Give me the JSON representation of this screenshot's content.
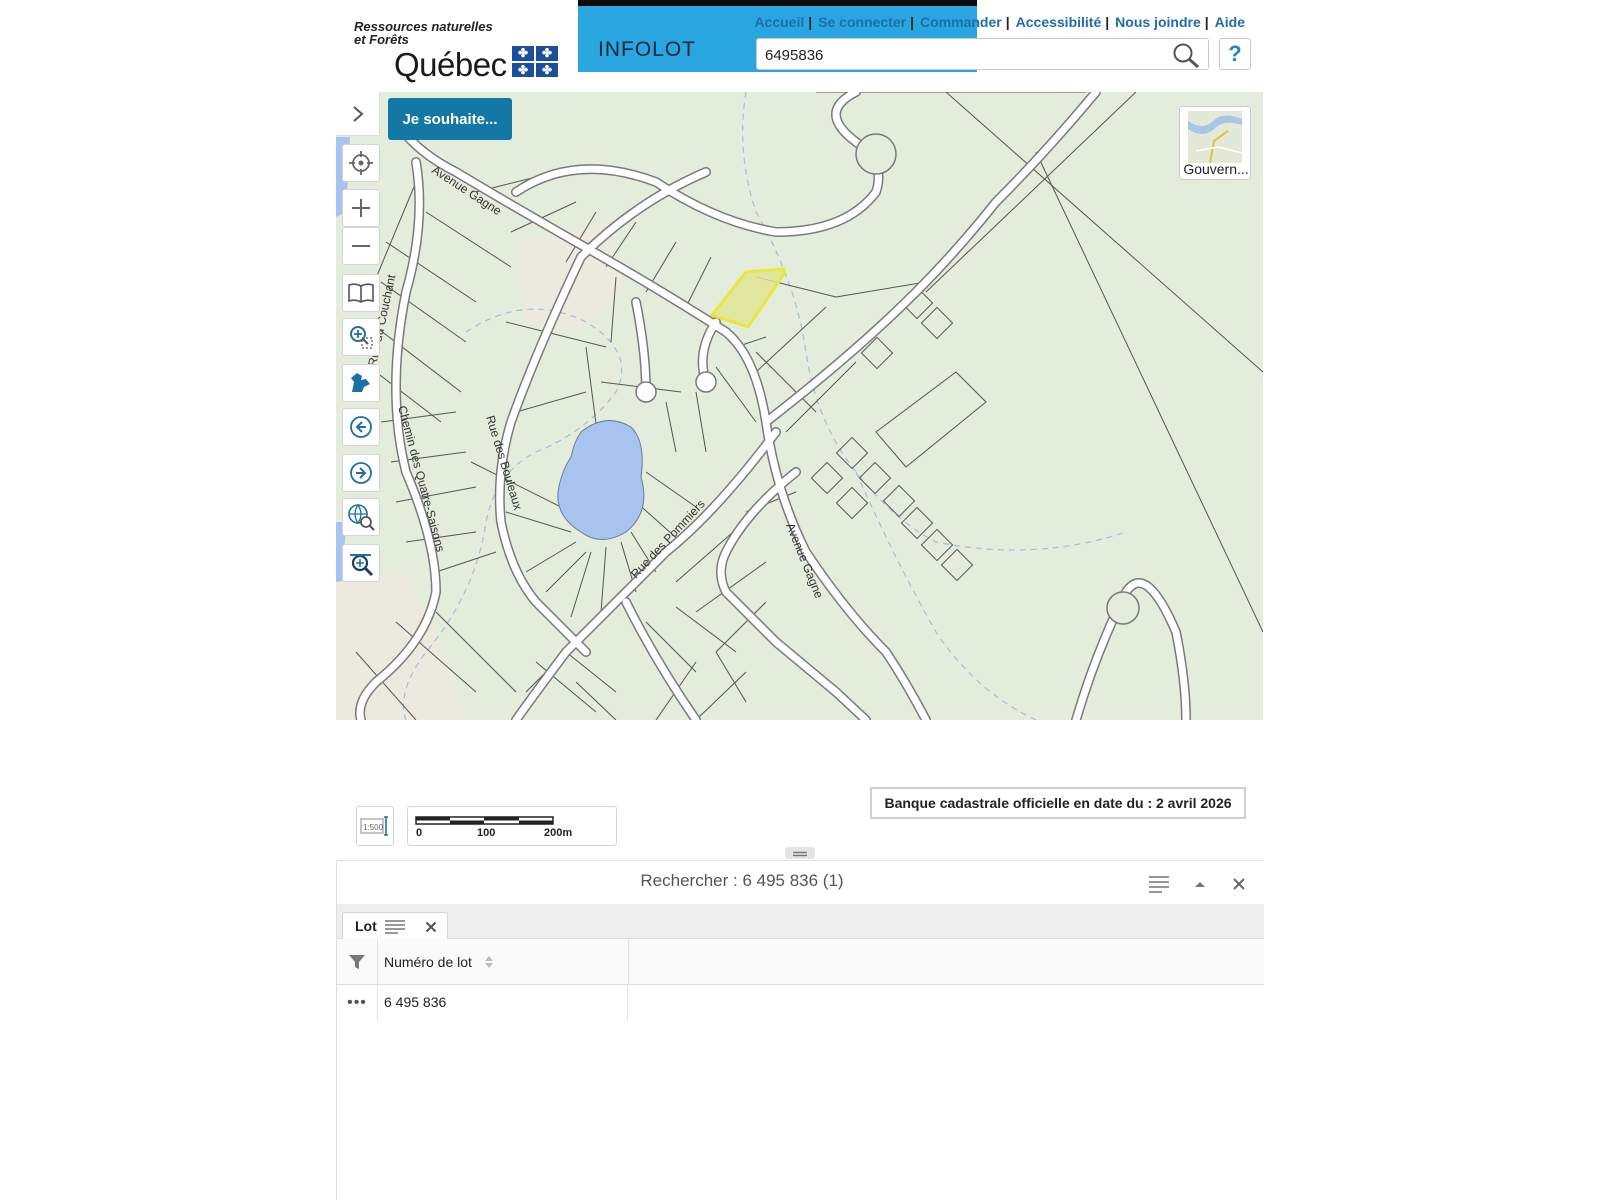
{
  "header": {
    "logo_line1": "Ressources naturelles",
    "logo_line2": "et Forêts",
    "logo_wordmark": "Québec",
    "app_name": "INFOLOT",
    "nav": [
      {
        "label": "Accueil"
      },
      {
        "label": "Se connecter"
      },
      {
        "label": "Commander"
      },
      {
        "label": "Accessibilité"
      },
      {
        "label": "Nous joindre"
      },
      {
        "label": "Aide"
      }
    ],
    "nav_separator": "|",
    "search_value": "6495836",
    "help_label": "?"
  },
  "map": {
    "je_souhaite_label": "Je souhaite...",
    "basemap_label": "Gouvern...",
    "street_labels": {
      "avenue_gagne_top": "Avenue Gagne",
      "rue_du_couchant": "Rue du Couchant",
      "chemin_quatre_saisons": "Chemin des Quatre-Saisons",
      "rue_des_bouleaux": "Rue des Bouleaux",
      "rue_des_pommiers": "Rue des Pommiers",
      "avenue_gagne_right": "Avenue Gagne"
    },
    "tools": [
      {
        "icon": "locate-icon"
      },
      {
        "icon": "zoom-in-icon"
      },
      {
        "icon": "zoom-out-icon"
      },
      {
        "icon": "legend-book-icon"
      },
      {
        "icon": "zoom-box-icon"
      },
      {
        "icon": "quebec-extent-icon"
      },
      {
        "icon": "back-arrow-icon"
      },
      {
        "icon": "forward-arrow-icon"
      },
      {
        "icon": "globe-search-icon"
      },
      {
        "icon": "zoom-search-icon"
      }
    ],
    "highlight_color": "#e8e83a"
  },
  "scale": {
    "ratio_label": "1:500",
    "bar_labels": [
      "0",
      "100",
      "200m"
    ]
  },
  "cadastre_date": "Banque cadastrale officielle en date du : 2 avril 2026",
  "results": {
    "title": "Rechercher : 6 495 836 (1)",
    "tab_label": "Lot",
    "column_header": "Numéro de lot",
    "rows": [
      {
        "menu": "•••",
        "lot_number": "6 495 836"
      }
    ]
  },
  "colors": {
    "banner": "#29a6e0",
    "accent": "#1478a7",
    "nav_link": "#1e6fa6",
    "map_background": "#e4ecdc",
    "lake": "#a8c4ee"
  }
}
